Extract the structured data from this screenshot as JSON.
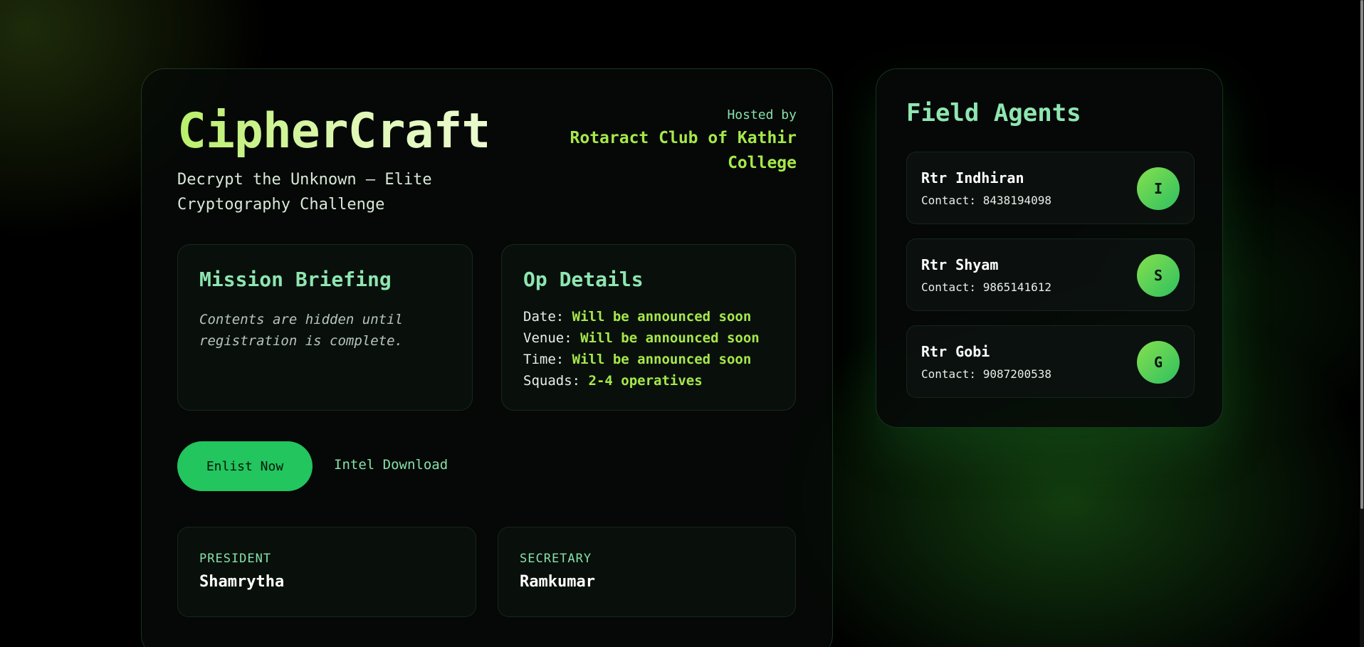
{
  "event": {
    "title": "CipherCraft",
    "subtitle": "Decrypt the Unknown — Elite Cryptography Challenge"
  },
  "host": {
    "label": "Hosted by",
    "name": "Rotaract Club of Kathir College"
  },
  "mission": {
    "title": "Mission Briefing",
    "text": "Contents are hidden until registration is complete."
  },
  "op_details": {
    "title": "Op Details",
    "rows": [
      {
        "label": "Date:",
        "value": "Will be announced soon"
      },
      {
        "label": "Venue:",
        "value": "Will be announced soon"
      },
      {
        "label": "Time:",
        "value": "Will be announced soon"
      },
      {
        "label": "Squads:",
        "value": "2-4 operatives"
      }
    ]
  },
  "actions": {
    "enlist_label": "Enlist Now",
    "intel_label": "Intel Download"
  },
  "roles": [
    {
      "label": "PRESIDENT",
      "name": "Shamrytha"
    },
    {
      "label": "SECRETARY",
      "name": "Ramkumar"
    }
  ],
  "agents": {
    "title": "Field Agents",
    "items": [
      {
        "name": "Rtr Indhiran",
        "contact": "Contact: 8438194098",
        "initial": "I"
      },
      {
        "name": "Rtr Shyam",
        "contact": "Contact: 9865141612",
        "initial": "S"
      },
      {
        "name": "Rtr Gobi",
        "contact": "Contact: 9087200538",
        "initial": "G"
      }
    ]
  },
  "colors": {
    "accent": "#22c55e",
    "highlight": "#a6e84a",
    "heading": "#8ee6b0"
  }
}
